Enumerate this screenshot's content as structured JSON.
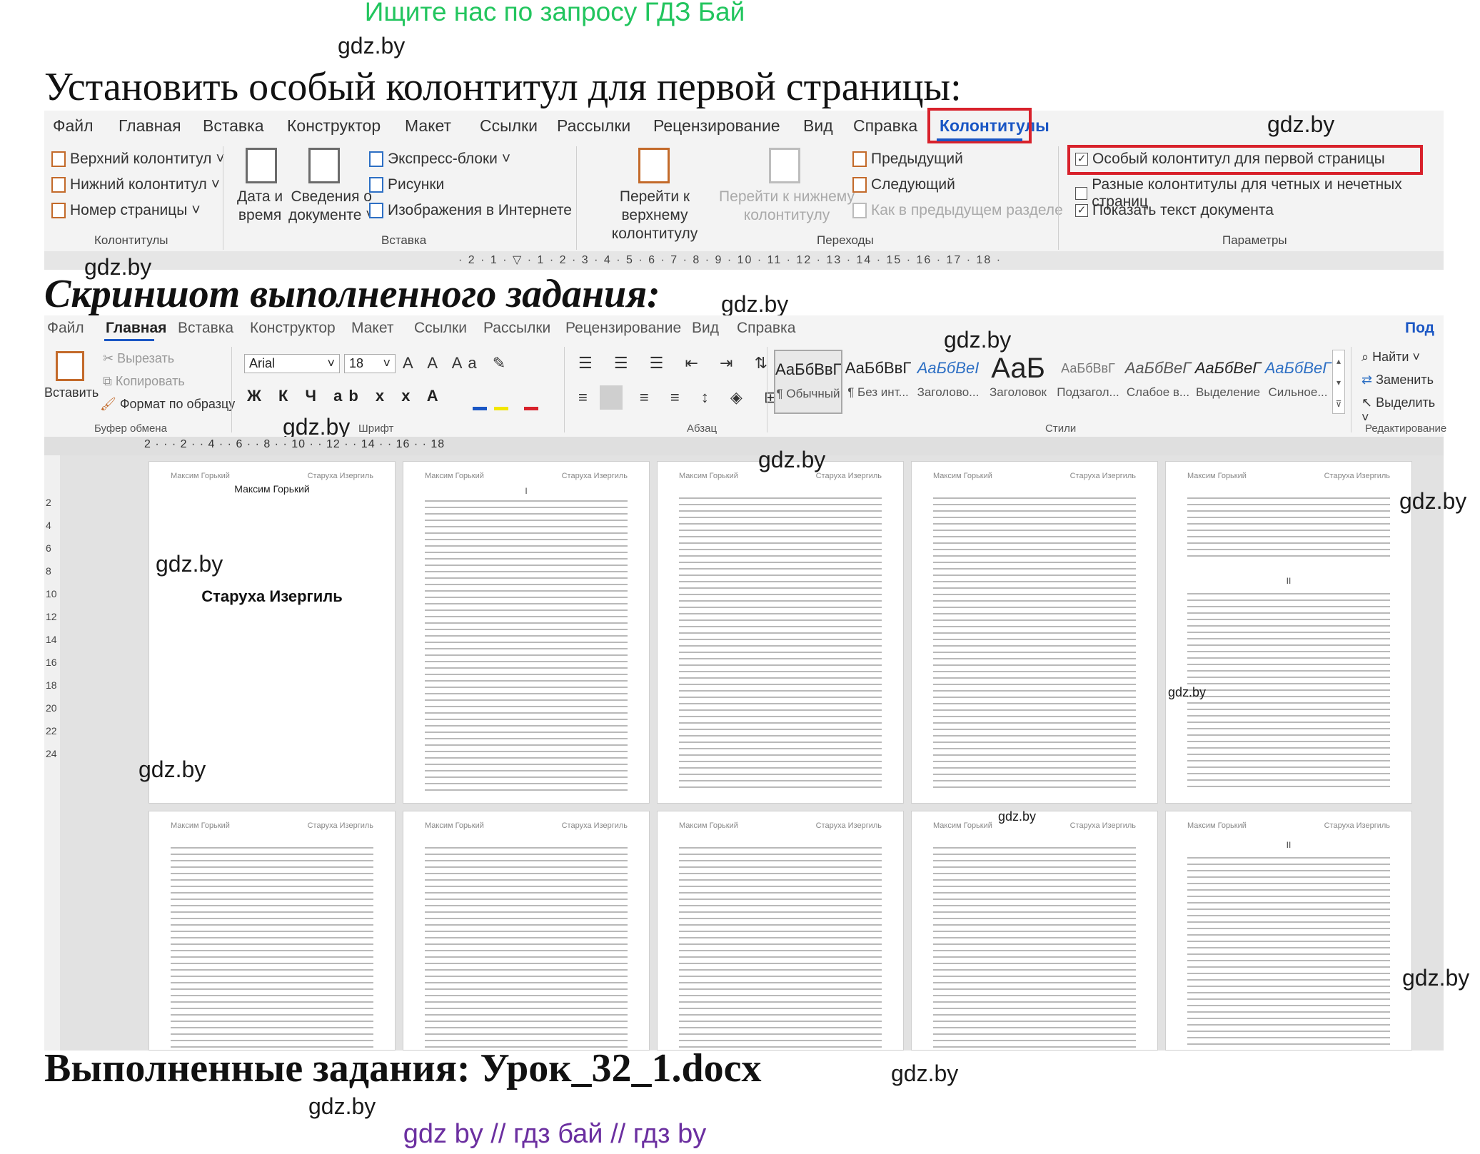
{
  "top_banner": "Ищите нас по запросу ГДЗ Бай",
  "watermark": "gdz.by",
  "task_heading": "Установить особый колонтитул для первой страницы:",
  "ribbon1": {
    "tabs": [
      "Файл",
      "Главная",
      "Вставка",
      "Конструктор",
      "Макет",
      "Ссылки",
      "Рассылки",
      "Рецензирование",
      "Вид",
      "Справка",
      "Колонтитулы"
    ],
    "header_footer": {
      "header": "Верхний колонтитул",
      "footer": "Нижний колонтитул",
      "page_number": "Номер страницы",
      "group": "Колонтитулы"
    },
    "insert": {
      "date_time_l1": "Дата и",
      "date_time_l2": "время",
      "doc_info_l1": "Сведения о",
      "doc_info_l2": "документе",
      "quick_parts": "Экспресс-блоки",
      "pictures": "Рисунки",
      "online_pictures": "Изображения в Интернете",
      "group": "Вставка"
    },
    "navigation": {
      "goto_header_l1": "Перейти к верхнему",
      "goto_header_l2": "колонтитулу",
      "goto_footer_l1": "Перейти к нижнему",
      "goto_footer_l2": "колонтитулу",
      "previous": "Предыдущий",
      "next": "Следующий",
      "link_previous": "Как в предыдущем разделе",
      "group": "Переходы"
    },
    "options": {
      "different_first": "Особый колонтитул для первой страницы",
      "different_odd_even": "Разные колонтитулы для четных и нечетных страниц",
      "show_doc_text": "Показать текст документа",
      "group": "Параметры"
    },
    "ruler": "· 2 · 1 · ▽ · 1 · 2 · 3 · 4 · 5 · 6 · 7 · 8 · 9 · 10 · 11 · 12 · 13 · 14 · 15 · 16 · 17 · 18 ·"
  },
  "screenshot_heading": "Скриншот выполненного задания:",
  "ribbon2": {
    "tabs": [
      "Файл",
      "Главная",
      "Вставка",
      "Конструктор",
      "Макет",
      "Ссылки",
      "Рассылки",
      "Рецензирование",
      "Вид",
      "Справка"
    ],
    "share": "Под",
    "clipboard": {
      "paste": "Вставить",
      "cut": "Вырезать",
      "copy": "Копировать",
      "format_painter": "Формат по образцу",
      "group": "Буфер обмена"
    },
    "font": {
      "name": "Arial",
      "size": "18",
      "group": "Шрифт"
    },
    "paragraph_group": "Абзац",
    "styles": [
      {
        "sample": "АаБбВвГ",
        "name": "¶ Обычный"
      },
      {
        "sample": "АаБбВвГ",
        "name": "¶ Без инт..."
      },
      {
        "sample": "АаБбВеI",
        "name": "Заголово..."
      },
      {
        "sample": "АаБ",
        "name": "Заголовок"
      },
      {
        "sample": "АаБбВвГ",
        "name": "Подзагол..."
      },
      {
        "sample": "АаБбВеГ",
        "name": "Слабое в..."
      },
      {
        "sample": "АаБбВеГ",
        "name": "Выделение"
      },
      {
        "sample": "АаБбВеГ",
        "name": "Сильное..."
      }
    ],
    "styles_group": "Стили",
    "editing": {
      "find": "Найти",
      "replace": "Заменить",
      "select": "Выделить",
      "group": "Редактирование"
    },
    "ruler": "2 · · · 2 · · 4 · · 6 · · 8 · · 10 · · 12 · · 14 · · 16 · · 18"
  },
  "document": {
    "header_left": "Максим Горький",
    "header_right": "Старуха Изергиль",
    "first_page_author": "Максим Горький",
    "first_page_title": "Старуха Изергиль",
    "chapter_1": "I",
    "chapter_2": "II",
    "vertical_ruler": [
      "2",
      "4",
      "6",
      "8",
      "10",
      "12",
      "14",
      "16",
      "18",
      "20",
      "22",
      "24"
    ]
  },
  "result_heading": "Выполненные задания: Урок_32_1.docx",
  "footer_links": "gdz by  //  гдз бай  //  гдз by"
}
